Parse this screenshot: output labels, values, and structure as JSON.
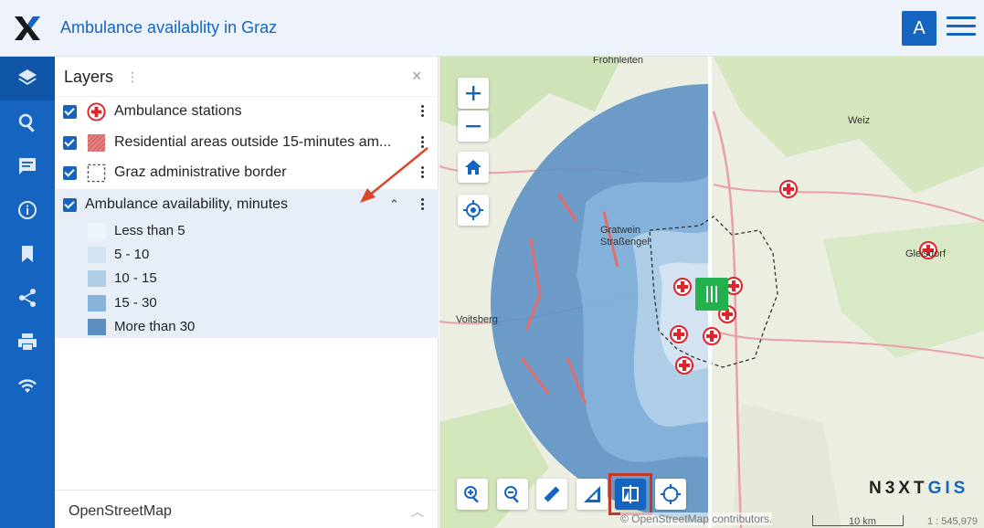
{
  "header": {
    "title": "Ambulance availablity in Graz",
    "avatar_letter": "A"
  },
  "sidebar": {
    "items": [
      {
        "icon": "layers-icon"
      },
      {
        "icon": "search-icon"
      },
      {
        "icon": "message-icon"
      },
      {
        "icon": "info-icon"
      },
      {
        "icon": "bookmark-icon"
      },
      {
        "icon": "share-icon"
      },
      {
        "icon": "print-icon"
      },
      {
        "icon": "wifi-icon"
      }
    ]
  },
  "panel": {
    "title": "Layers",
    "layers": [
      {
        "label": "Ambulance stations",
        "checked": true,
        "icon": "ambulance-cross-icon"
      },
      {
        "label": "Residential areas outside 15-minutes am...",
        "checked": true,
        "icon": "red-hatched-square-icon"
      },
      {
        "label": "Graz administrative border",
        "checked": true,
        "icon": "dashed-square-icon"
      }
    ],
    "group": {
      "label": "Ambulance availability, minutes",
      "checked": true,
      "legend": [
        {
          "label": "Less than 5",
          "color": "#eef4fb"
        },
        {
          "label": "5 - 10",
          "color": "#d3e3f1"
        },
        {
          "label": "10 - 15",
          "color": "#b0cfe7"
        },
        {
          "label": "15 - 30",
          "color": "#86b4da"
        },
        {
          "label": "More than 30",
          "color": "#5b8fc4"
        }
      ]
    },
    "basemap": "OpenStreetMap"
  },
  "map": {
    "places": [
      "Frohnleiten",
      "Weiz",
      "Gratwein Straßengel",
      "Voitsberg",
      "Gleisdorf"
    ],
    "brand_left": "N3XT",
    "brand_right": "GIS",
    "attribution": "© OpenStreetMap contributors.",
    "scale_label": "10 km",
    "scale_ratio": "1 : 545,979"
  },
  "colors": {
    "accent": "#1565c0",
    "swipe": "#22b14c",
    "highlight": "#c0392b",
    "ambulance": "#e0242b"
  }
}
